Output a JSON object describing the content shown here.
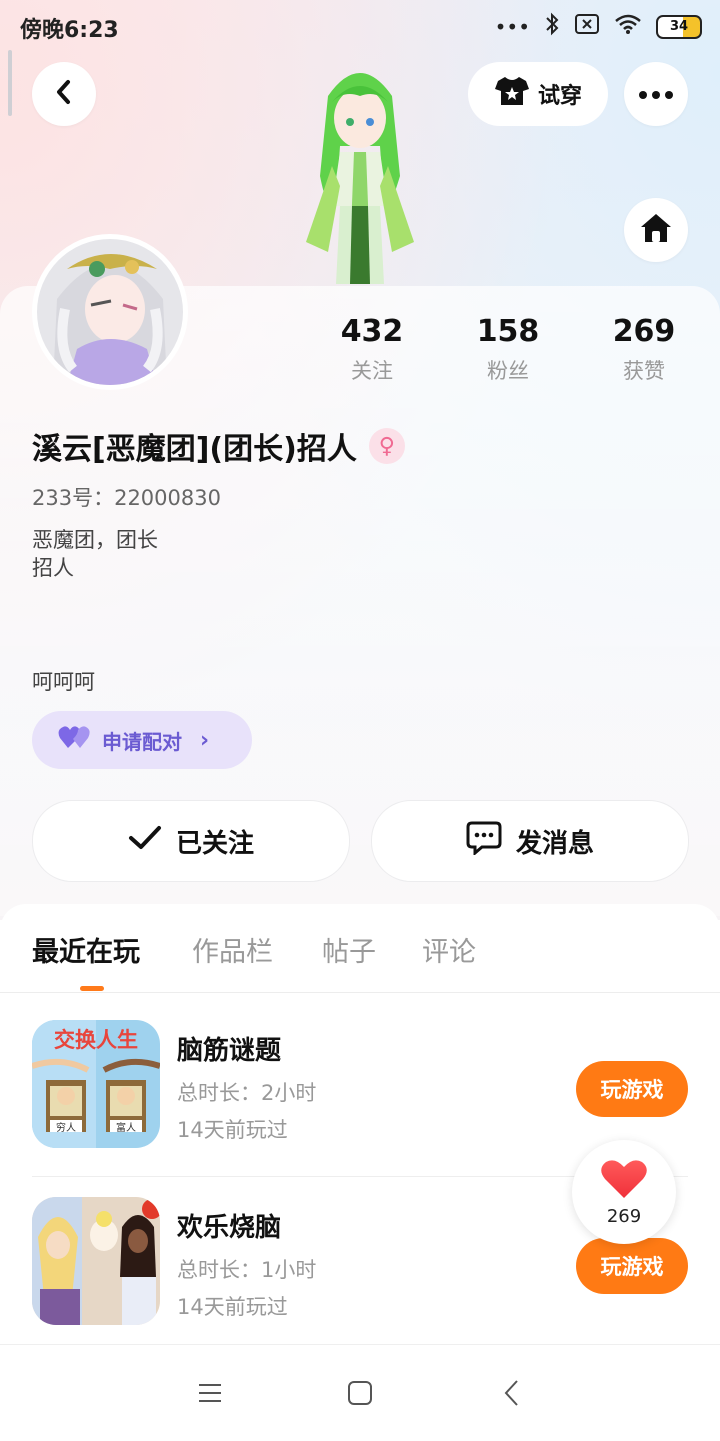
{
  "status_bar": {
    "time": "傍晚6:23",
    "battery": "34",
    "icons": [
      "more-dots-icon",
      "bluetooth-icon",
      "sim-off-icon",
      "wifi-icon",
      "battery-icon"
    ]
  },
  "header": {
    "back_icon": "chevron-left-icon",
    "try_on_label": "试穿",
    "try_on_icon": "shirt-icon",
    "more_icon": "more-horizontal-icon",
    "home_icon": "home-icon"
  },
  "profile": {
    "stats": [
      {
        "value": "432",
        "label": "关注"
      },
      {
        "value": "158",
        "label": "粉丝"
      },
      {
        "value": "269",
        "label": "获赞"
      }
    ],
    "name": "溪云[恶魔团](团长)招人",
    "gender_icon": "female-icon",
    "id_line": "233号：22000830",
    "bio_line1": "恶魔团，团长",
    "bio_line2": "招人",
    "signature": "呵呵呵",
    "pair_label": "申请配对"
  },
  "actions": {
    "follow_label": "已关注",
    "message_label": "发消息"
  },
  "tabs": [
    {
      "label": "最近在玩",
      "active": true
    },
    {
      "label": "作品栏",
      "active": false
    },
    {
      "label": "帖子",
      "active": false
    },
    {
      "label": "评论",
      "active": false
    }
  ],
  "games": [
    {
      "title": "脑筋谜题",
      "duration": "总时长：2小时",
      "last_played": "14天前玩过",
      "button": "玩游戏",
      "icon_text": "交换人生",
      "icon_sub1": "穷人",
      "icon_sub2": "富人"
    },
    {
      "title": "欢乐烧脑",
      "duration": "总时长：1小时",
      "last_played": "14天前玩过",
      "button": "玩游戏"
    }
  ],
  "like_float": {
    "count": "269"
  },
  "colors": {
    "accent": "#ff7a14",
    "pair_bg": "#e8e2fa",
    "pair_text": "#6b5bd2"
  }
}
